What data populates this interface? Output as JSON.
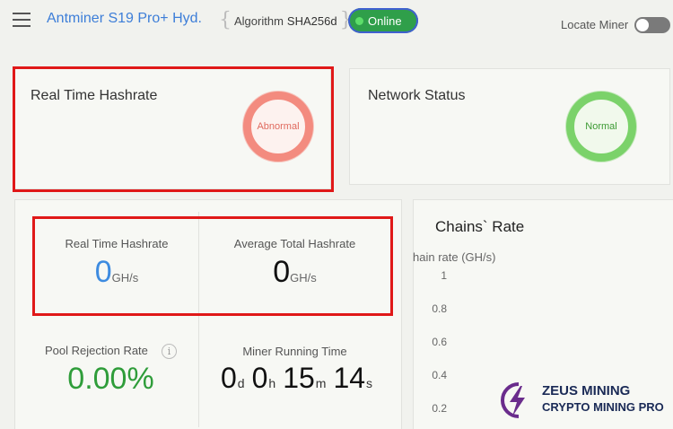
{
  "header": {
    "title": "Antminer S19 Pro+ Hyd.",
    "algorithm_label": "Algorithm",
    "algorithm_value": "SHA256d",
    "status": "Online",
    "locate_label": "Locate Miner",
    "locate_enabled": false
  },
  "cards": {
    "hashrate": {
      "title": "Real Time Hashrate",
      "status": "Abnormal"
    },
    "network": {
      "title": "Network Status",
      "status": "Normal"
    }
  },
  "stats": {
    "realtime_label": "Real Time Hashrate",
    "realtime_value": "0",
    "realtime_unit": "GH/s",
    "average_label": "Average Total Hashrate",
    "average_value": "0",
    "average_unit": "GH/s",
    "rejection_label": "Pool Rejection Rate",
    "rejection_info": "i",
    "rejection_value": "0.00%",
    "runtime_label": "Miner Running Time",
    "runtime": {
      "d": "0",
      "d_unit": "d",
      "h": "0",
      "h_unit": "h",
      "m": "15",
      "m_unit": "m",
      "s": "14",
      "s_unit": "s"
    }
  },
  "chart": {
    "title": "Chains` Rate",
    "axis_title": "hain rate (GH/s)",
    "ticks": [
      "1",
      "0.8",
      "0.6",
      "0.4",
      "0.2"
    ]
  },
  "watermark": {
    "line1": "ZEUS MINING",
    "line2": "CRYPTO MINING PRO"
  },
  "colors": {
    "accent": "#3d7ed8",
    "online": "#2f9f4a",
    "abnormal": "#f38b7f",
    "normal": "#7bd26a",
    "highlight": "#e01818"
  }
}
